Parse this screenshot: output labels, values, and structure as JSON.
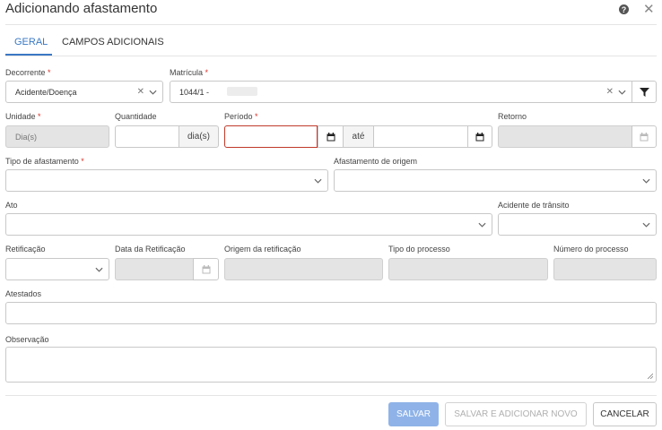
{
  "header": {
    "title": "Adicionando afastamento",
    "help_icon": "question-circle-icon",
    "close_icon": "close-icon"
  },
  "tabs": [
    {
      "label": "GERAL",
      "active": true
    },
    {
      "label": "CAMPOS ADICIONAIS",
      "active": false
    }
  ],
  "form": {
    "decorrente": {
      "label": "Decorrente",
      "required": "*",
      "value": "Acidente/Doença"
    },
    "matricula": {
      "label": "Matrícula",
      "required": "*",
      "value": "1044/1 -"
    },
    "unidade": {
      "label": "Unidade",
      "required": "*",
      "value": "Dia(s)"
    },
    "quantidade": {
      "label": "Quantidade",
      "value": "",
      "suffix": "dia(s)"
    },
    "periodo": {
      "label": "Período",
      "required": "*",
      "start": "",
      "separator": "até",
      "end": ""
    },
    "retorno": {
      "label": "Retorno",
      "value": ""
    },
    "tipo_afastamento": {
      "label": "Tipo de afastamento",
      "required": "*",
      "value": ""
    },
    "afastamento_origem": {
      "label": "Afastamento de origem",
      "value": ""
    },
    "ato": {
      "label": "Ato",
      "value": ""
    },
    "acidente_transito": {
      "label": "Acidente de trânsito",
      "value": ""
    },
    "retificacao": {
      "label": "Retificação",
      "value": ""
    },
    "data_retificacao": {
      "label": "Data da Retificação",
      "value": ""
    },
    "origem_retificacao": {
      "label": "Origem da retificação",
      "value": ""
    },
    "tipo_processo": {
      "label": "Tipo do processo",
      "value": ""
    },
    "numero_processo": {
      "label": "Número do processo",
      "value": ""
    },
    "atestados": {
      "label": "Atestados",
      "value": ""
    },
    "observacao": {
      "label": "Observação",
      "value": ""
    }
  },
  "buttons": {
    "save": "SALVAR",
    "save_new": "SALVAR E ADICIONAR NOVO",
    "cancel": "CANCELAR"
  },
  "colors": {
    "accent": "#3a78c4",
    "required": "#d9342b",
    "error_border": "#c0392b",
    "save_bg": "#8fb3e8"
  }
}
